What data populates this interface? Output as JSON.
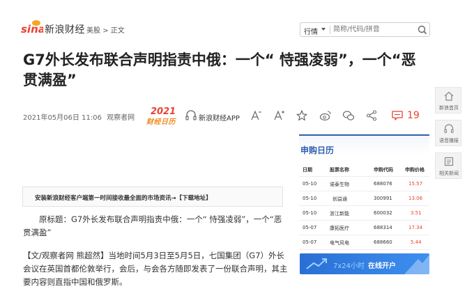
{
  "header": {
    "logo_text": "sina",
    "brand": "新浪财经",
    "breadcrumb": [
      "美股",
      ">",
      "正文"
    ],
    "search": {
      "select_label": "行情",
      "placeholder": "简称/代码/拼音"
    }
  },
  "article": {
    "title": "G7外长发布联合声明指责中俄：一个“ 恃强凌弱”，一个“恶贯满盈”",
    "date": "2021年05月06日 11:06",
    "source": "观察者网",
    "calendar_badge": {
      "year": "2021",
      "text": "财经日历"
    },
    "app_label": "新浪财经APP",
    "comment_count": "19",
    "app_banner": "安装新浪财经客户端第一时间接收最全面的市场资讯→【下载地址】",
    "paragraphs": [
      "原标题：G7外长发布联合声明指责中俄：一个“ 恃强凌弱”，一个“恶贯满盈”",
      "【文/观察者网 熊超然】当地时间5月3日至5月5日，七国集团（G7）外长会议在英国首都伦敦举行，会后，与会各方随即发表了一份联合声明，其主要内容则直指中国和俄罗斯。"
    ]
  },
  "side_tools": [
    {
      "label": "新浪首页",
      "icon": "home-icon"
    },
    {
      "label": "语音播报",
      "icon": "headphones-icon"
    },
    {
      "label": "相关新闻",
      "icon": "news-icon"
    }
  ],
  "shengou": {
    "title": "申购日历",
    "columns": [
      "日期",
      "股票名称",
      "申购代码",
      "申购价格"
    ],
    "rows": [
      [
        "05-10",
        "诺泰生物",
        "688076",
        "15.57"
      ],
      [
        "05-10",
        "创益通",
        "300991",
        "13.06"
      ],
      [
        "05-10",
        "浙江新能",
        "600032",
        "3.51"
      ],
      [
        "05-07",
        "康拓医疗",
        "688314",
        "17.34"
      ],
      [
        "05-07",
        "电气风电",
        "688660",
        "5.44"
      ]
    ]
  },
  "banner": {
    "text1": "7x24小时",
    "text2": "在线开户"
  },
  "colors": {
    "accent_red": "#e8432f",
    "accent_blue": "#2f5fb0"
  }
}
